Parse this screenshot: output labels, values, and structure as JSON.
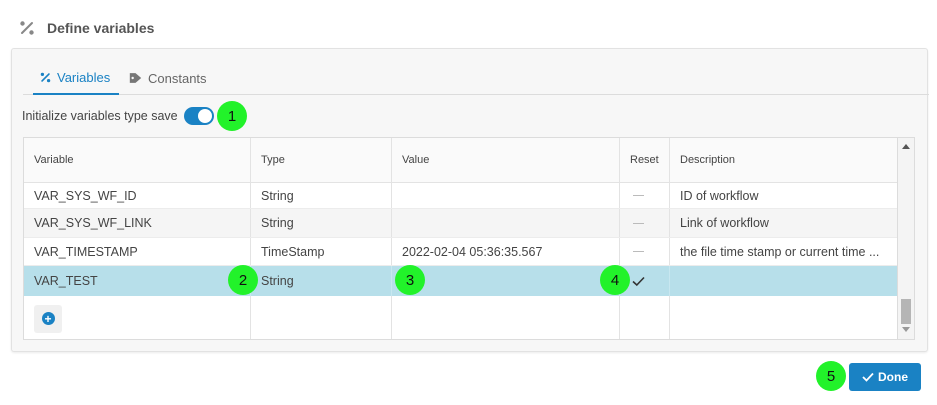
{
  "header": {
    "title": "Define variables",
    "icon": "percent-icon"
  },
  "tabs": [
    {
      "label": "Variables",
      "icon": "percent-icon",
      "active": true
    },
    {
      "label": "Constants",
      "icon": "tag-icon",
      "active": false
    }
  ],
  "toggle": {
    "label": "Initialize variables type save",
    "enabled": true
  },
  "table": {
    "columns": [
      "Variable",
      "Type",
      "Value",
      "Reset",
      "Description"
    ],
    "rows": [
      {
        "variable": "VAR_SYS_WF_ID",
        "type": "String",
        "value": "",
        "reset": false,
        "description": "ID of workflow"
      },
      {
        "variable": "VAR_SYS_WF_LINK",
        "type": "String",
        "value": "",
        "reset": false,
        "description": "Link of workflow"
      },
      {
        "variable": "VAR_TIMESTAMP",
        "type": "TimeStamp",
        "value": "2022-02-04 05:36:35.567",
        "reset": false,
        "description": "the file time stamp or current time ..."
      },
      {
        "variable": "VAR_TEST",
        "type": "String",
        "value": "",
        "reset": true,
        "description": "",
        "selected": true
      }
    ],
    "add_icon": "plus-circle-icon"
  },
  "markers": [
    "1",
    "2",
    "3",
    "4",
    "5"
  ],
  "footer": {
    "done_label": "Done",
    "done_icon": "check-icon"
  },
  "colors": {
    "accent": "#1a82c4",
    "selected_row": "#b7dfea",
    "marker": "#22f22a"
  }
}
